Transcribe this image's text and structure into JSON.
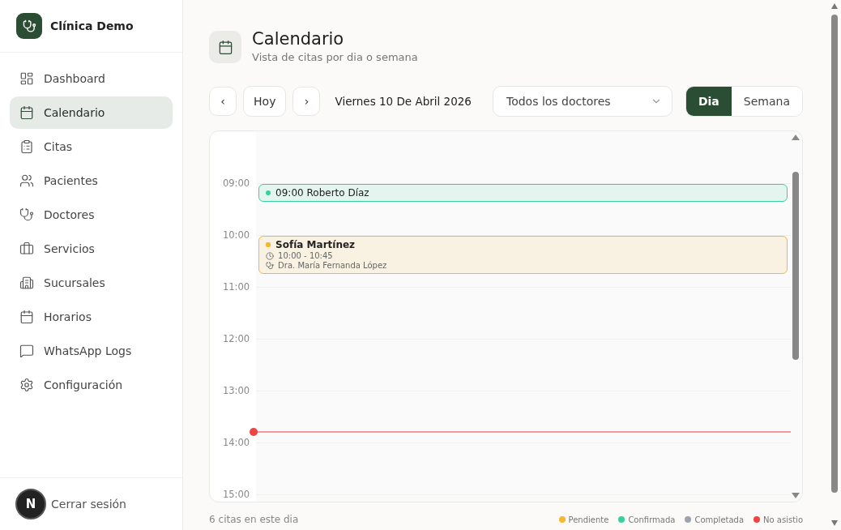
{
  "brand": {
    "name": "Clínica Demo"
  },
  "sidebar": {
    "items": [
      {
        "label": "Dashboard",
        "selected": false
      },
      {
        "label": "Calendario",
        "selected": true
      },
      {
        "label": "Citas",
        "selected": false
      },
      {
        "label": "Pacientes",
        "selected": false
      },
      {
        "label": "Doctores",
        "selected": false
      },
      {
        "label": "Servicios",
        "selected": false
      },
      {
        "label": "Sucursales",
        "selected": false
      },
      {
        "label": "Horarios",
        "selected": false
      },
      {
        "label": "WhatsApp Logs",
        "selected": false
      },
      {
        "label": "Configuración",
        "selected": false
      }
    ],
    "logout": "Cerrar sesión",
    "badge": "N"
  },
  "header": {
    "title": "Calendario",
    "subtitle": "Vista de citas por dia o semana"
  },
  "toolbar": {
    "prev": "‹",
    "today": "Hoy",
    "next": "›",
    "date": "Viernes 10 De Abril 2026",
    "doctor_select": "Todos los doctores",
    "views": [
      {
        "label": "Dia",
        "selected": true
      },
      {
        "label": "Semana",
        "selected": false
      }
    ]
  },
  "calendar": {
    "hours": [
      {
        "label": "09:00",
        "events": [
          {
            "kind": "compact",
            "title": "09:00 Roberto Díaz",
            "color": "#34d399"
          }
        ]
      },
      {
        "label": "10:00",
        "events": [
          {
            "kind": "detailed",
            "title": "Sofía Martínez",
            "time": "10:00 - 10:45",
            "doctor": "Dra. María Fernanda López",
            "color": "#f5b82e"
          }
        ]
      },
      {
        "label": "11:00",
        "now_line": false
      },
      {
        "label": "12:00",
        "now_line": false
      },
      {
        "label": "13:00",
        "now_line": true
      },
      {
        "label": "14:00",
        "now_line": false
      },
      {
        "label": "15:00",
        "now_line": false
      }
    ]
  },
  "footer": {
    "count": "6 citas en este dia",
    "legend": [
      {
        "label": "Pendiente",
        "color": "#f5b82e"
      },
      {
        "label": "Confirmada",
        "color": "#34d399"
      },
      {
        "label": "Completada",
        "color": "#9ca3af"
      },
      {
        "label": "No asistio",
        "color": "#ef4444"
      }
    ]
  }
}
